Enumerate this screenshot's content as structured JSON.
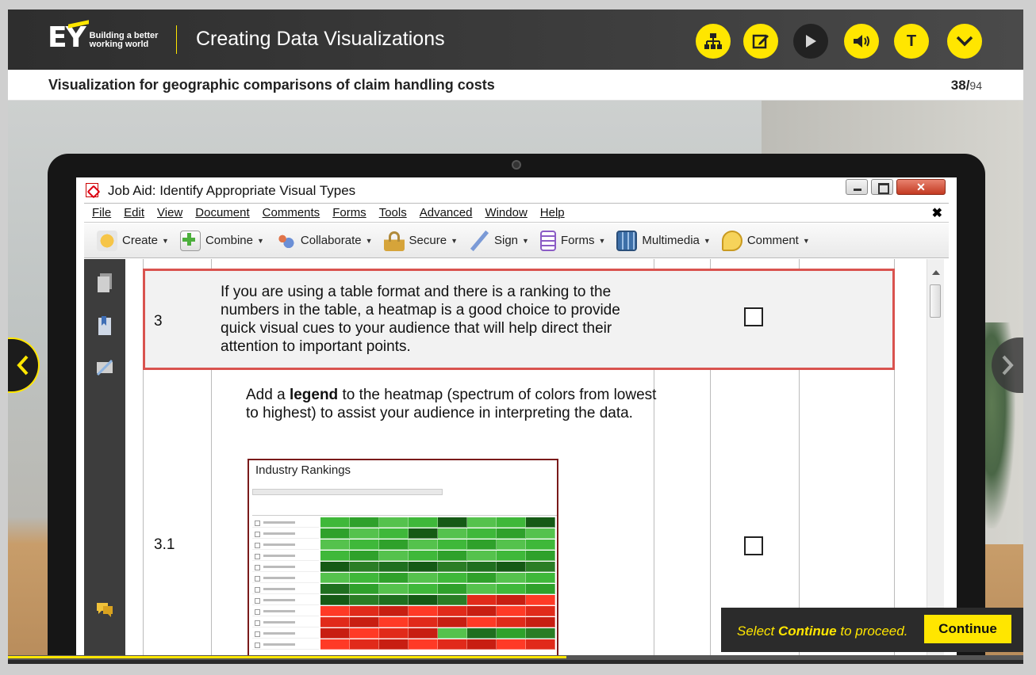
{
  "header": {
    "logo_text": "EY",
    "tagline_line1": "Building a better",
    "tagline_line2": "working world",
    "course_title": "Creating Data Visualizations",
    "buttons": [
      {
        "name": "menu-structure-button",
        "icon": "sitemap-icon"
      },
      {
        "name": "notes-button",
        "icon": "edit-note-icon"
      },
      {
        "name": "play-button",
        "icon": "play-icon"
      },
      {
        "name": "audio-button",
        "icon": "volume-icon"
      },
      {
        "name": "transcript-button",
        "icon": "letter-t-icon",
        "label": "T"
      },
      {
        "name": "more-menu-button",
        "icon": "chevron-down-icon"
      }
    ]
  },
  "slide": {
    "title": "Visualization for geographic comparisons of claim handling costs",
    "page_current": "38/",
    "page_total": "94"
  },
  "acrobat": {
    "window_title": "Job Aid: Identify Appropriate Visual Types",
    "menu": [
      "File",
      "Edit",
      "View",
      "Document",
      "Comments",
      "Forms",
      "Tools",
      "Advanced",
      "Window",
      "Help"
    ],
    "toolbar": [
      {
        "label": "Create",
        "icon": "create-pdf-icon",
        "color": "#f2b33d"
      },
      {
        "label": "Combine",
        "icon": "combine-files-icon",
        "color": "#5bb64b"
      },
      {
        "label": "Collaborate",
        "icon": "collaborate-icon",
        "color": "#6b8fd6"
      },
      {
        "label": "Secure",
        "icon": "lock-icon",
        "color": "#d6a43a"
      },
      {
        "label": "Sign",
        "icon": "pen-icon",
        "color": "#7b9ad6"
      },
      {
        "label": "Forms",
        "icon": "form-icon",
        "color": "#8b5cc5"
      },
      {
        "label": "Multimedia",
        "icon": "film-icon",
        "color": "#3d6fa8"
      },
      {
        "label": "Comment",
        "icon": "speech-bubble-icon",
        "color": "#f0c23a"
      }
    ],
    "close_x": "✖"
  },
  "document": {
    "row3_number": "3",
    "row3_text": "If you are using a table format and there is a ranking to the numbers in the table, a heatmap is a good choice to provide quick visual cues to your audience that will help direct their attention to important points.",
    "row31_number": "3.1",
    "row31_text_pre": "Add a ",
    "row31_text_bold": "legend",
    "row31_text_post": " to the heatmap (spectrum of colors from lowest to highest) to assist your audience in interpreting the data.",
    "heatmap_title": "Industry Rankings"
  },
  "continue": {
    "msg_pre": "Select ",
    "msg_bold": "Continue",
    "msg_post": " to proceed.",
    "button_label": "Continue"
  },
  "progress": {
    "fraction": 0.55
  },
  "colors": {
    "accent": "#ffe600",
    "dark": "#2e2e2e",
    "highlight_border": "#d9534f"
  }
}
